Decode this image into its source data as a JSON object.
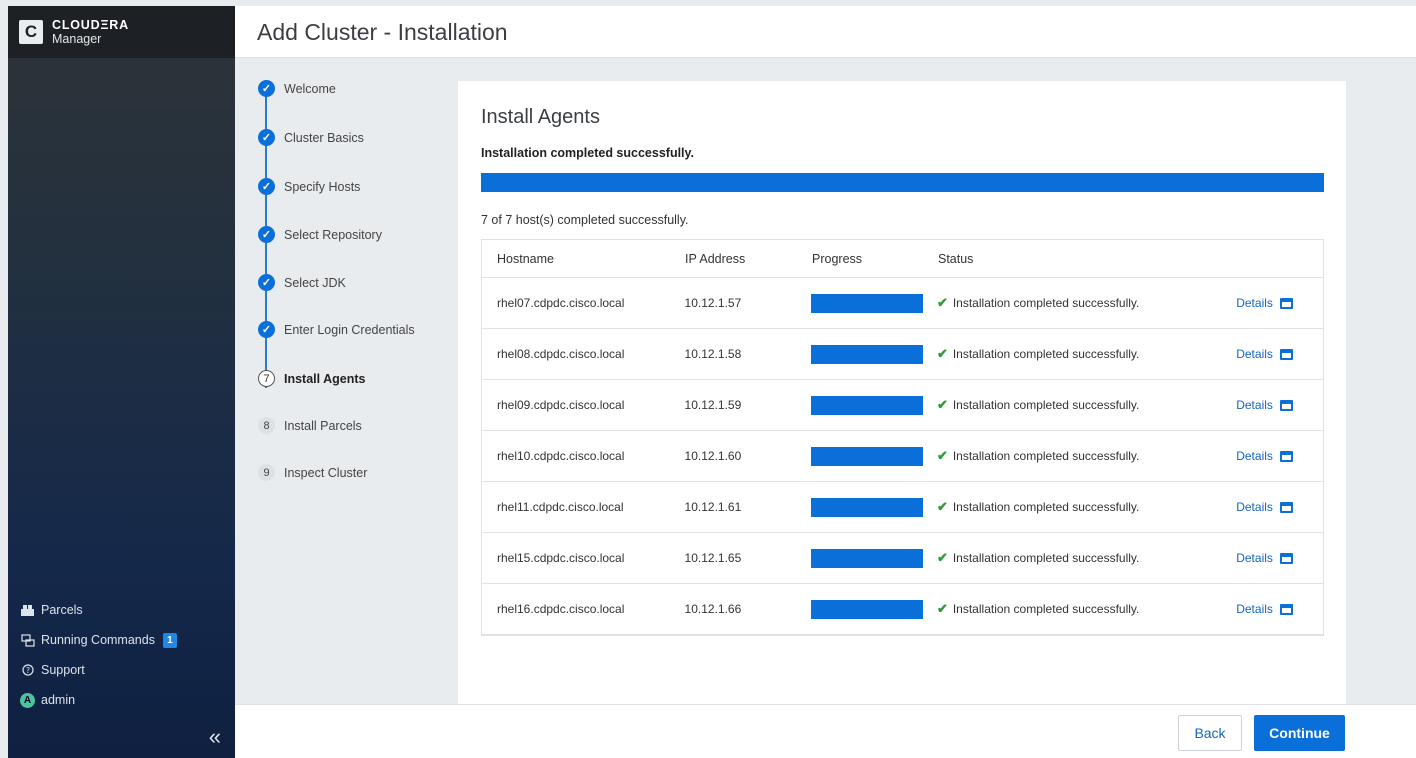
{
  "brand": {
    "logo_letter": "C",
    "name": "CLOUDΞRA",
    "product": "Manager"
  },
  "sidebar": {
    "items": [
      {
        "label": "Parcels",
        "icon": "parcels-icon"
      },
      {
        "label": "Running Commands",
        "icon": "running-commands-icon",
        "badge": "1"
      },
      {
        "label": "Support",
        "icon": "support-icon"
      },
      {
        "label": "admin",
        "icon": "avatar",
        "avatar_letter": "A"
      }
    ],
    "collapse_glyph": "«"
  },
  "header": {
    "title": "Add Cluster - Installation"
  },
  "wizard": {
    "steps": [
      {
        "number": "1",
        "label": "Welcome",
        "state": "done"
      },
      {
        "number": "2",
        "label": "Cluster Basics",
        "state": "done"
      },
      {
        "number": "3",
        "label": "Specify Hosts",
        "state": "done"
      },
      {
        "number": "4",
        "label": "Select Repository",
        "state": "done"
      },
      {
        "number": "5",
        "label": "Select JDK",
        "state": "done"
      },
      {
        "number": "6",
        "label": "Enter Login Credentials",
        "state": "done"
      },
      {
        "number": "7",
        "label": "Install Agents",
        "state": "current"
      },
      {
        "number": "8",
        "label": "Install Parcels",
        "state": "todo"
      },
      {
        "number": "9",
        "label": "Inspect Cluster",
        "state": "todo"
      }
    ]
  },
  "main": {
    "title": "Install Agents",
    "message": "Installation completed successfully.",
    "overall_progress": 1.0,
    "summary": "7 of 7 host(s) completed successfully.",
    "table": {
      "columns": [
        "Hostname",
        "IP Address",
        "Progress",
        "Status"
      ],
      "rows": [
        {
          "hostname": "rhel07.cdpdc.cisco.local",
          "ip": "10.12.1.57",
          "progress": 1.0,
          "status": "Installation completed successfully.",
          "details": "Details"
        },
        {
          "hostname": "rhel08.cdpdc.cisco.local",
          "ip": "10.12.1.58",
          "progress": 1.0,
          "status": "Installation completed successfully.",
          "details": "Details"
        },
        {
          "hostname": "rhel09.cdpdc.cisco.local",
          "ip": "10.12.1.59",
          "progress": 1.0,
          "status": "Installation completed successfully.",
          "details": "Details"
        },
        {
          "hostname": "rhel10.cdpdc.cisco.local",
          "ip": "10.12.1.60",
          "progress": 1.0,
          "status": "Installation completed successfully.",
          "details": "Details"
        },
        {
          "hostname": "rhel11.cdpdc.cisco.local",
          "ip": "10.12.1.61",
          "progress": 1.0,
          "status": "Installation completed successfully.",
          "details": "Details"
        },
        {
          "hostname": "rhel15.cdpdc.cisco.local",
          "ip": "10.12.1.65",
          "progress": 1.0,
          "status": "Installation completed successfully.",
          "details": "Details"
        },
        {
          "hostname": "rhel16.cdpdc.cisco.local",
          "ip": "10.12.1.66",
          "progress": 1.0,
          "status": "Installation completed successfully.",
          "details": "Details"
        }
      ]
    }
  },
  "footer": {
    "back_label": "Back",
    "continue_label": "Continue"
  },
  "colors": {
    "accent": "#0a6fd8",
    "success": "#2e9a3a",
    "sidebar_top": "#2e3338",
    "sidebar_bottom": "#0f2040"
  }
}
